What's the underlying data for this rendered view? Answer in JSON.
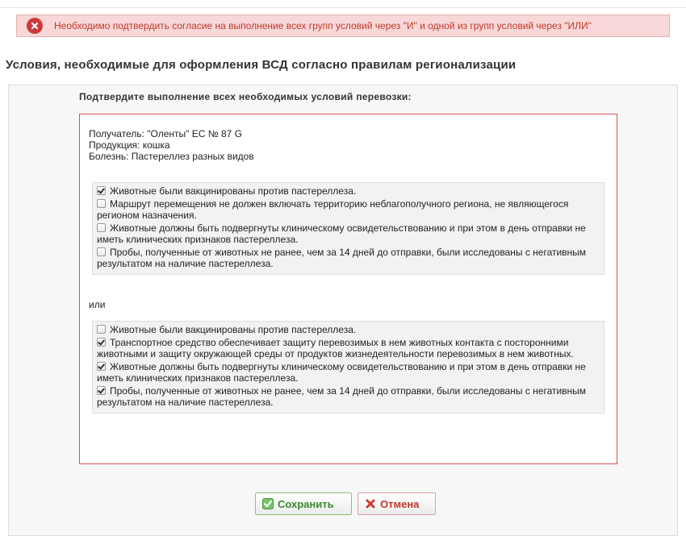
{
  "error": {
    "message": "Необходимо подтвердить согласие на выполнение всех групп условий через \"И\" и одной из групп условий через \"ИЛИ\""
  },
  "page": {
    "title": "Условия, необходимые для оформления ВСД согласно правилам регионализации",
    "subtitle": "Подтвердите выполнение всех необходимых условий перевозки:"
  },
  "info": {
    "recipient": "Получатель: \"Оленты\" EC № 87 G",
    "product": "Продукция: кошка",
    "disease": "Болезнь: Пастереллез разных видов"
  },
  "groups": [
    {
      "conditions": [
        {
          "text": "Животные были вакцинированы против пастереллеза.",
          "checked": true
        },
        {
          "text": "Маршрут перемещения не должен включать территорию неблагополучного региона, не являющегося регионом назначения.",
          "checked": false
        },
        {
          "text": "Животные должны быть подвергнуты клиническому освидетельствованию и при этом в день отправки не иметь клинических признаков пастереллеза.",
          "checked": false
        },
        {
          "text": "Пробы, полученные от животных не ранее, чем за 14 дней до отправки, были исследованы с негативным результатом на наличие пастереллеза.",
          "checked": false
        }
      ]
    },
    {
      "conditions": [
        {
          "text": "Животные были вакцинированы против пастереллеза.",
          "checked": false
        },
        {
          "text": "Транспортное средство обеспечивает защиту перевозимых в нем животных контакта с посторонними животными и защиту окружающей среды от продуктов жизнедеятельности перевозимых в нем животных.",
          "checked": true
        },
        {
          "text": "Животные должны быть подвергнуты клиническому освидетельствованию и при этом в день отправки не иметь клинических признаков пастереллеза.",
          "checked": true
        },
        {
          "text": "Пробы, полученные от животных не ранее, чем за 14 дней до отправки, были исследованы с негативным результатом на наличие пастереллеза.",
          "checked": true
        }
      ]
    }
  ],
  "or_label": "или",
  "buttons": {
    "save": "Сохранить",
    "cancel": "Отмена"
  },
  "colors": {
    "error_bg": "#f7d7d7",
    "error_text": "#c0392b",
    "red_border": "#d9534f",
    "save_green": "#3a8a2e"
  },
  "icons": {
    "error": "error-x-circle-icon",
    "save": "checkmark-icon",
    "cancel": "cross-icon"
  }
}
